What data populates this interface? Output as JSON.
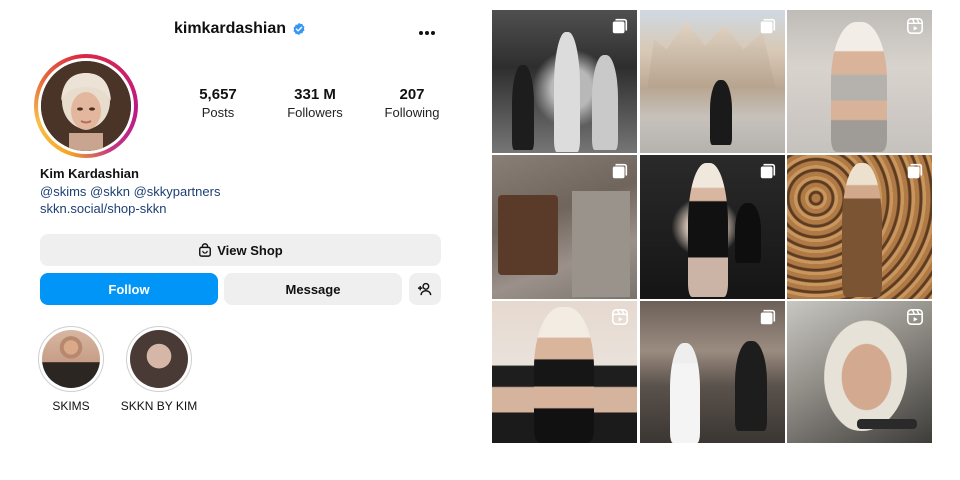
{
  "profile": {
    "username": "kimkardashian",
    "verified_icon": "verified-badge-icon",
    "more_icon": "more-horizontal-icon",
    "stats": {
      "posts": {
        "value": "5,657",
        "label": "Posts"
      },
      "followers": {
        "value": "331 M",
        "label": "Followers"
      },
      "following": {
        "value": "207",
        "label": "Following"
      }
    },
    "bio": {
      "name": "Kim Kardashian",
      "tags": "@skims @skkn @skkypartners",
      "link": "skkn.social/shop-skkn"
    }
  },
  "actions": {
    "view_shop": "View Shop",
    "follow": "Follow",
    "message": "Message"
  },
  "highlights": [
    {
      "label": "SKIMS"
    },
    {
      "label": "SKKN BY KIM"
    }
  ],
  "grid": {
    "tiles": [
      {
        "type": "carousel"
      },
      {
        "type": "carousel"
      },
      {
        "type": "reel"
      },
      {
        "type": "carousel"
      },
      {
        "type": "carousel"
      },
      {
        "type": "carousel"
      },
      {
        "type": "reel"
      },
      {
        "type": "carousel"
      },
      {
        "type": "reel"
      }
    ]
  },
  "colors": {
    "follow_button": "#0095f6",
    "secondary_button": "#efefef",
    "link": "#1c3f74",
    "verified": "#3897f0"
  }
}
